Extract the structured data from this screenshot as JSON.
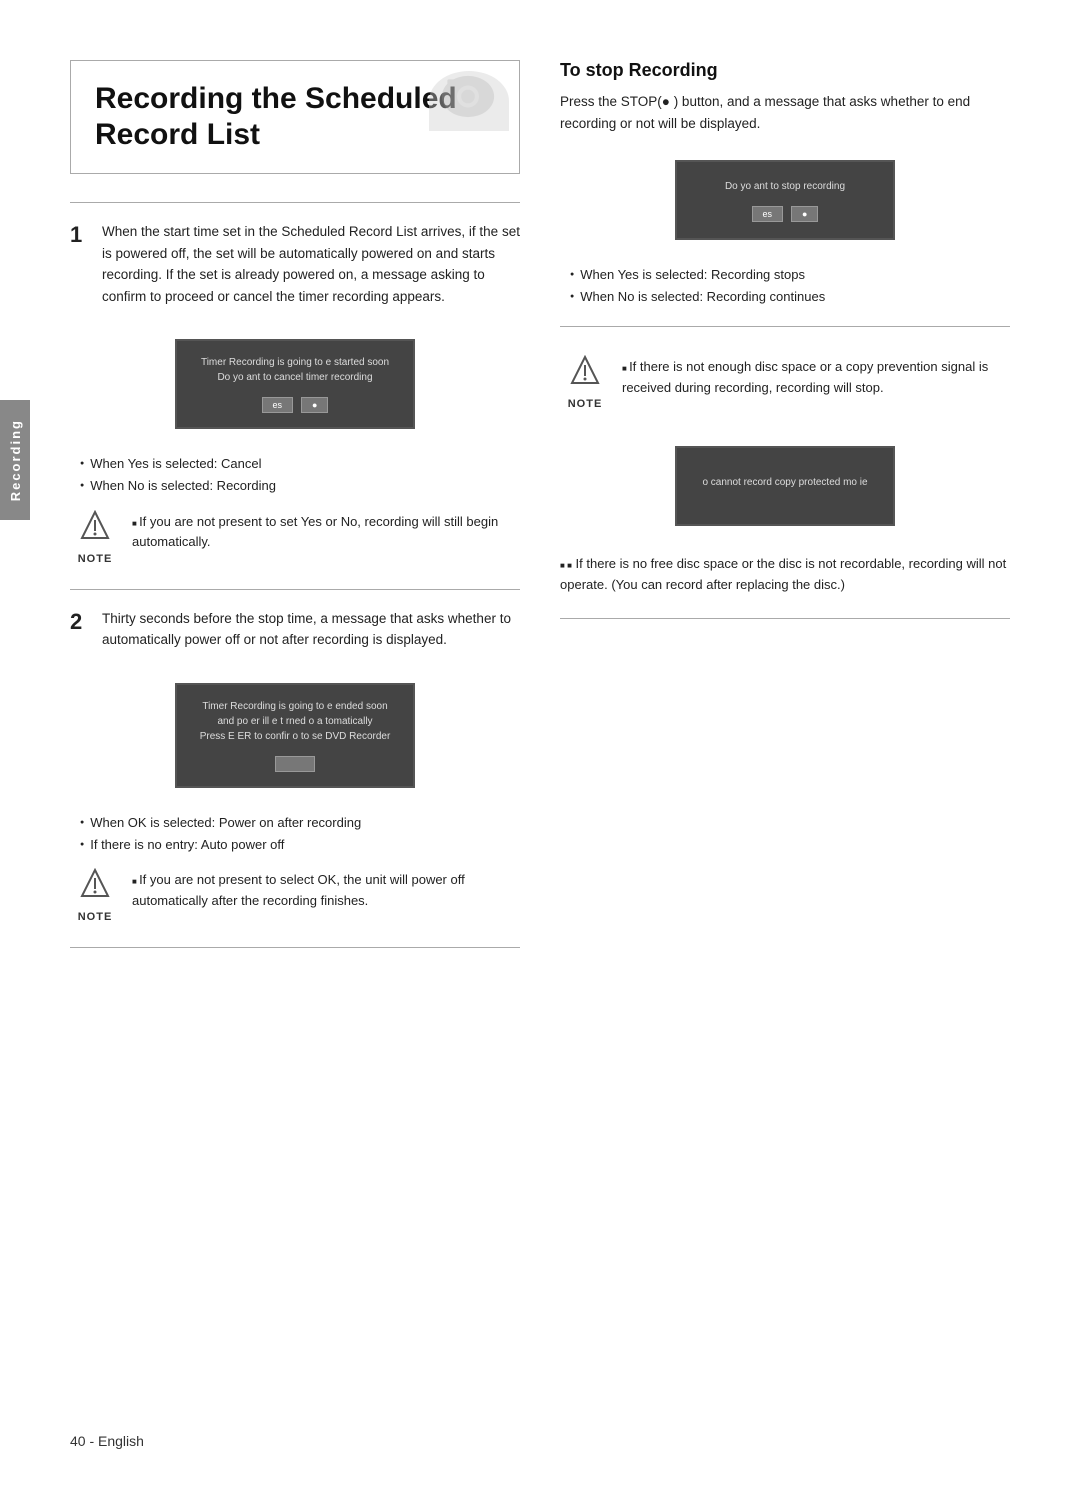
{
  "page": {
    "footer": "40 - English",
    "side_tab": "Recording"
  },
  "title": {
    "line1": "Recording the Scheduled",
    "line2": "Record List"
  },
  "steps": [
    {
      "num": "1",
      "text": "When the start time set in the Scheduled Record List arrives, if the set is powered off, the set will be automatically powered on and starts recording. If the set is already powered on, a message asking to confirm to proceed or cancel the timer recording appears.",
      "screen": {
        "line1": "Timer Recording is going to  e started soon",
        "line2": "Do yo    ant to cancel timer recording",
        "btn1": "es",
        "btn2": "●"
      },
      "bullets": [
        "When  Yes  is selected: Cancel",
        "When  No  is selected: Recording"
      ],
      "note": "If you are not present to set Yes or No, recording will still begin automatically."
    },
    {
      "num": "2",
      "text": "Thirty seconds before the stop time, a message that asks whether to automatically power off or not after recording is displayed.",
      "screen": {
        "line1": "Timer Recording is going to  e ended soon",
        "line2": "and po er  ill  e t rned o  a tomatically",
        "line3": "Press E  ER to confir  o to  se DVD Recorder",
        "btn1": ""
      },
      "bullets": [
        "When  OK  is selected: Power on after recording",
        "If there is no entry: Auto power off"
      ],
      "note": "If you are not present to select OK, the unit will power off automatically after the recording finishes."
    }
  ],
  "right_col": {
    "heading": "To stop Recording",
    "intro": "Press the STOP(●  ) button, and a message that asks whether to end recording or not will be displayed.",
    "screen": {
      "line1": "Do yo    ant to stop recording",
      "btn1": "es",
      "btn2": "●"
    },
    "bullets": [
      "When  Yes  is selected: Recording stops",
      "When  No  is selected: Recording continues"
    ],
    "note1": {
      "text": "If there is not enough disc space or a copy prevention signal is received during recording, recording will stop."
    },
    "note2_screen": {
      "line1": "o  cannot record copy protected mo  ie"
    },
    "note2_text": "If there is no free disc space or the disc is not recordable, recording will not operate. (You can record after replacing the disc.)"
  }
}
